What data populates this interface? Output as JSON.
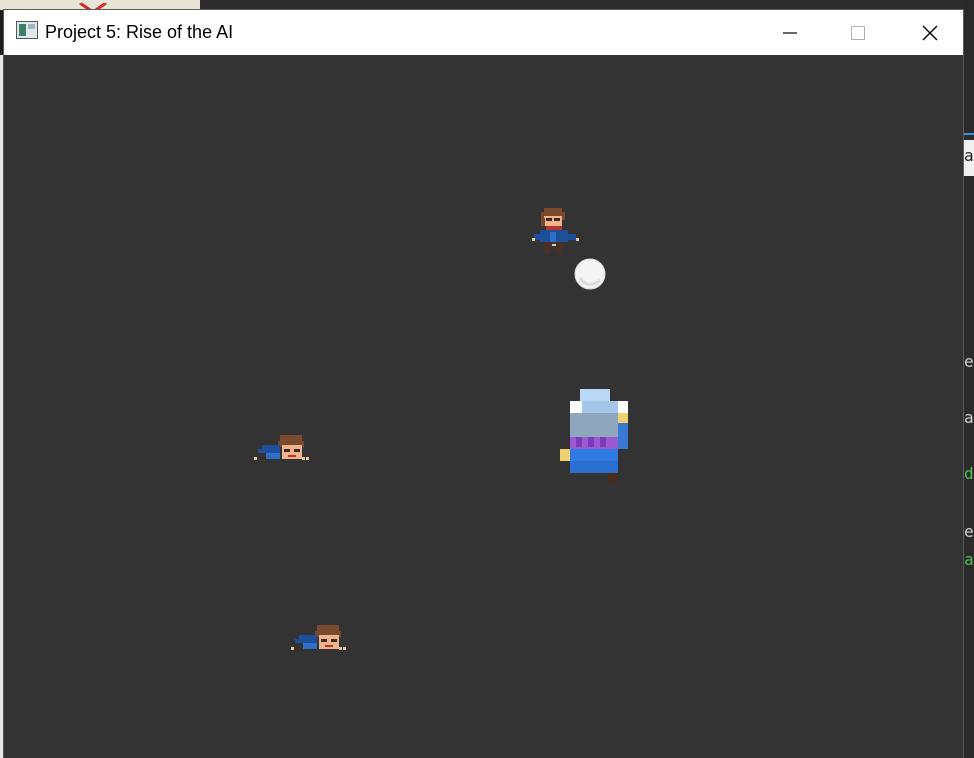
{
  "window": {
    "title": "Project 5: Rise of the AI",
    "app_icon": "window-app-icon",
    "controls": {
      "minimize_icon": "minimize-icon",
      "maximize_icon": "maximize-icon",
      "close_icon": "close-icon"
    }
  },
  "game": {
    "background_color": "#333333",
    "entities": [
      {
        "name": "enemy-standing",
        "kind": "enemy-character"
      },
      {
        "name": "snowball",
        "kind": "projectile"
      },
      {
        "name": "player-mage",
        "kind": "player"
      },
      {
        "name": "enemy-knocked-down-1",
        "kind": "enemy-defeated"
      },
      {
        "name": "enemy-knocked-down-2",
        "kind": "enemy-defeated"
      }
    ]
  },
  "background_fragments": [
    "a",
    "e",
    "a",
    "d",
    "e",
    "a"
  ]
}
